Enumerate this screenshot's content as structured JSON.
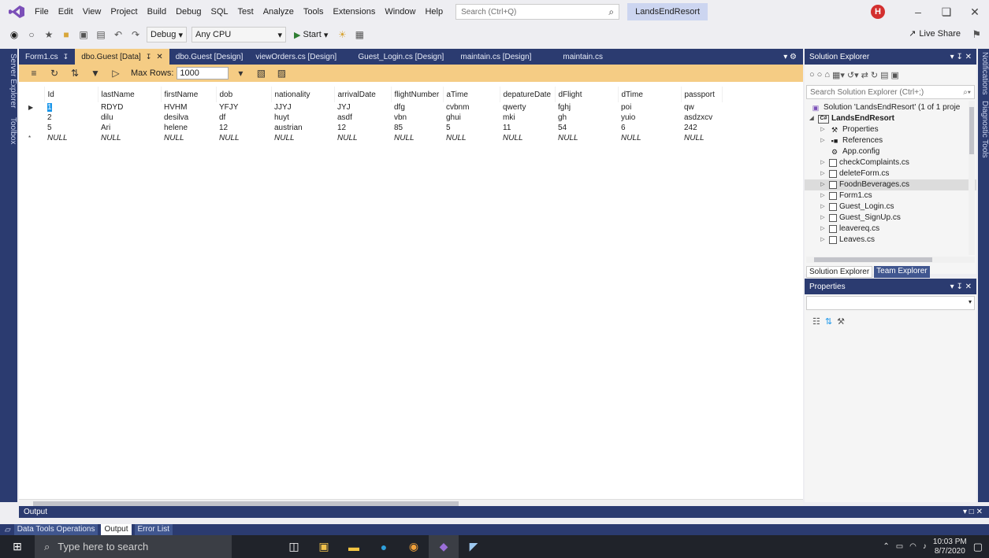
{
  "menu": {
    "items": [
      "File",
      "Edit",
      "View",
      "Project",
      "Build",
      "Debug",
      "SQL",
      "Test",
      "Analyze",
      "Tools",
      "Extensions",
      "Window",
      "Help"
    ],
    "search_placeholder": "Search (Ctrl+Q)",
    "solution_name": "LandsEndResort",
    "user_initial": "H"
  },
  "toolbar": {
    "config": "Debug",
    "platform": "Any CPU",
    "start_label": "Start",
    "live_share": "Live Share"
  },
  "side_tabs": [
    "Server Explorer",
    "Toolbox"
  ],
  "right_tabs": [
    "Notifications",
    "Diagnostic Tools"
  ],
  "doc_tabs": [
    {
      "label": "Form1.cs",
      "active": false
    },
    {
      "label": "dbo.Guest [Data]",
      "active": true
    },
    {
      "label": "dbo.Guest [Design]",
      "active": false
    },
    {
      "label": "viewOrders.cs [Design]",
      "active": false
    },
    {
      "label": "Guest_Login.cs [Design]",
      "active": false
    },
    {
      "label": "maintain.cs [Design]",
      "active": false
    },
    {
      "label": "maintain.cs",
      "active": false
    }
  ],
  "grid_toolbar": {
    "max_rows_label": "Max Rows:",
    "max_rows_value": "1000"
  },
  "grid": {
    "columns": [
      "Id",
      "lastName",
      "firstName",
      "dob",
      "nationality",
      "arrivalDate",
      "flightNumber",
      "aTime",
      "depatureDate",
      "dFlight",
      "dTime",
      "passport"
    ],
    "rows": [
      [
        "1",
        "RDYD",
        "HVHM",
        "YFJY",
        "JJYJ",
        "JYJ",
        "dfg",
        "cvbnm",
        "qwerty",
        "fghj",
        "poi",
        "qw"
      ],
      [
        "2",
        "dilu",
        "desilva",
        "df",
        "huyt",
        "asdf",
        "vbn",
        "ghui",
        "mki",
        "gh",
        "yuio",
        "asdzxcv"
      ],
      [
        "5",
        "Ari",
        "helene",
        "12",
        "austrian",
        "12",
        "85",
        "5",
        "11",
        "54",
        "6",
        "242"
      ],
      [
        "NULL",
        "NULL",
        "NULL",
        "NULL",
        "NULL",
        "NULL",
        "NULL",
        "NULL",
        "NULL",
        "NULL",
        "NULL",
        "NULL"
      ]
    ]
  },
  "solution_explorer": {
    "title": "Solution Explorer",
    "search_placeholder": "Search Solution Explorer (Ctrl+;)",
    "solution_line": "Solution 'LandsEndResort' (1 of 1 proje",
    "project": "LandsEndResort",
    "items": [
      {
        "label": "Properties",
        "icon": "wrench-icon",
        "arrow": true
      },
      {
        "label": "References",
        "icon": "references-icon",
        "arrow": true
      },
      {
        "label": "App.config",
        "icon": "config-icon",
        "arrow": false
      },
      {
        "label": "checkComplaints.cs",
        "icon": "form-icon",
        "arrow": true
      },
      {
        "label": "deleteForm.cs",
        "icon": "form-icon",
        "arrow": true
      },
      {
        "label": "FoodnBeverages.cs",
        "icon": "form-icon",
        "arrow": true,
        "hilite": true
      },
      {
        "label": "Form1.cs",
        "icon": "form-icon",
        "arrow": true
      },
      {
        "label": "Guest_Login.cs",
        "icon": "form-icon",
        "arrow": true
      },
      {
        "label": "Guest_SignUp.cs",
        "icon": "form-icon",
        "arrow": true
      },
      {
        "label": "leavereq.cs",
        "icon": "form-icon",
        "arrow": true
      },
      {
        "label": "Leaves.cs",
        "icon": "form-icon",
        "arrow": true
      }
    ],
    "bottom_tabs": [
      "Solution Explorer",
      "Team Explorer"
    ]
  },
  "properties": {
    "title": "Properties"
  },
  "output": {
    "title": "Output"
  },
  "bottom_tabs": [
    "Data Tools Operations",
    "Output",
    "Error List"
  ],
  "taskbar": {
    "search_placeholder": "Type here to search",
    "time": "10:03 PM",
    "date": "8/7/2020"
  }
}
